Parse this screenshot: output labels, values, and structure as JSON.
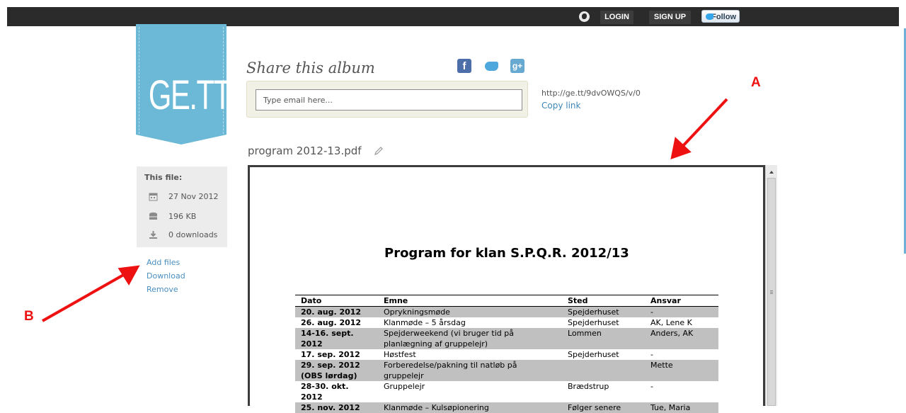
{
  "topbar": {
    "login_label": "LOGIN",
    "signup_label": "SIGN UP",
    "follow_label": "Follow"
  },
  "logo": {
    "text": "GE.TT"
  },
  "share": {
    "title": "Share this album",
    "email_placeholder": "Type email here...",
    "url": "http://ge.tt/9dvOWQS/v/0",
    "copy_label": "Copy link"
  },
  "file": {
    "name": "program 2012-13.pdf"
  },
  "file_info": {
    "title": "This file:",
    "date": "27 Nov 2012",
    "size": "196 KB",
    "downloads": "0 downloads"
  },
  "actions": {
    "add_files": "Add files",
    "download": "Download",
    "remove": "Remove"
  },
  "annotations": {
    "a": "A",
    "b": "B"
  },
  "document": {
    "title": "Program for klan S.P.Q.R.  2012/13",
    "headers": [
      "Dato",
      "Emne",
      "Sted",
      "Ansvar"
    ],
    "rows": [
      {
        "dato": "20. aug. 2012",
        "emne": "Oprykningsmøde",
        "sted": "Spejderhuset",
        "ansvar": "-",
        "shade": true
      },
      {
        "dato": "26. aug. 2012",
        "emne": "Klanmøde – 5 årsdag",
        "sted": "Spejderhuset",
        "ansvar": "AK, Lene K",
        "shade": false
      },
      {
        "dato": "14-16. sept. 2012",
        "emne": "Spejderweekend (vi bruger tid på planlægning af gruppelejr)",
        "sted": "Lommen",
        "ansvar": "Anders, AK",
        "shade": true
      },
      {
        "dato": "17. sep. 2012",
        "emne": "Høstfest",
        "sted": "Spejderhuset",
        "ansvar": "-",
        "shade": false
      },
      {
        "dato": "29. sep. 2012 (OBS lørdag)",
        "emne": "Forberedelse/pakning til natløb på gruppelejr",
        "sted": "",
        "ansvar": "Mette",
        "shade": true
      },
      {
        "dato": "28-30. okt. 2012",
        "emne": "Gruppelejr",
        "sted": "Brædstrup",
        "ansvar": "-",
        "shade": false
      },
      {
        "dato": "25. nov. 2012",
        "emne": "Klanmøde – Kulsøpionering",
        "sted": "Følger senere",
        "ansvar": "Tue, Maria",
        "shade": true
      }
    ]
  },
  "colors": {
    "accent": "#6bb9d7",
    "link": "#3c87b7",
    "annotation": "#ee1111"
  }
}
